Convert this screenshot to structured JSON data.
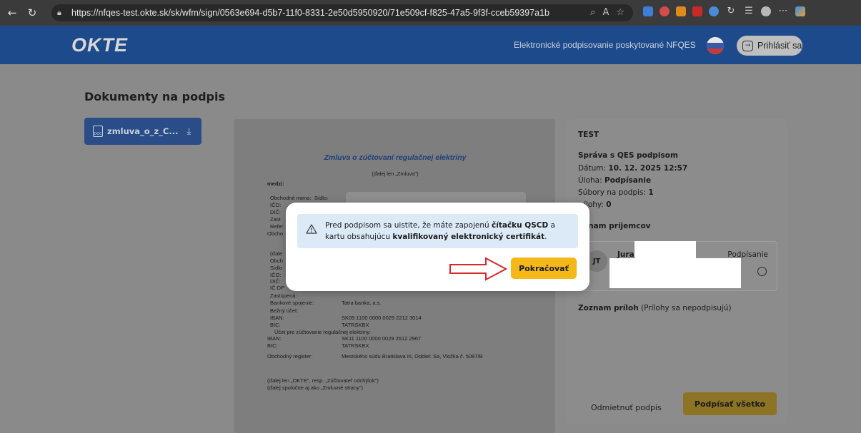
{
  "browser": {
    "url": "https://nfqes-test.okte.sk/sk/wfm/sign/0563e694-d5b7-11f0-8331-2e50d5950920/71e509cf-f825-47a5-9f3f-cceb59397a1b"
  },
  "header": {
    "logo": "OKTE",
    "service_text": "Elektronické podpisovanie poskytované NFQES",
    "login_label": "Prihlásiť sa"
  },
  "page": {
    "title": "Dokumenty na podpis",
    "document_tab": "zmluva_o_z_C..."
  },
  "document": {
    "title": "Zmluva o zúčtovaní regulačnej elektriny",
    "subtitle": "(ďalej len „Zmluva\")",
    "lines": {
      "medzi": "medzi:",
      "obchodne_meno": "Obchodné meno:",
      "sidlo": "Sídlo:",
      "ico": "IČO:",
      "dic": "DIČ:",
      "zast": "Zast",
      "refer": "Refer",
      "obcho": "Obcho",
      "dalej": "(ďale",
      "obch2": "Obch",
      "sidlo2": "Sídlo",
      "ico2": "IČO:",
      "dic2": "DIČ:",
      "icdph": "IČ DP",
      "zastupena": "Zastúpená:",
      "bankove_spojenie": "Bankové spojenie:",
      "bankove_spojenie_val": "Tatra banka, a.s.",
      "bezny_ucet": "Bežný účet:",
      "iban1": "IBAN:",
      "iban1_val": "SK09 1100 0000 0029 2212 3014",
      "bic1": "BIC:",
      "bic1_val": "TATRSKBX",
      "ucet_zuctovanie": "Účet pre zúčtovanie regulačnej elektriny:",
      "iban2": "IBAN:",
      "iban2_val": "SK11 1100 0000 0029 2612 2967",
      "bic2": "BIC:",
      "bic2_val": "TATRSKBX",
      "obchodny_register": "Obchodný register:",
      "obchodny_register_val": "Mestského súdu Bratislava III, Oddiel: Sa, Vložka č. 5087/B",
      "footer1": "(ďalej len „OKTE\", resp. „Zúčtovateľ odchýlok\")",
      "footer2": "(ďalej spoločne aj ako „Zmluvné strany\")"
    }
  },
  "info_panel": {
    "env": "TEST",
    "message_title": "Správa s QES podpisom",
    "date_label": "Dátum:",
    "date_value": "10. 12. 2025 12:57",
    "task_label": "Úloha:",
    "task_value": "Podpísanie",
    "files_label": "Súbory na podpis:",
    "files_value": "1",
    "attachments_label": "ílohy:",
    "attachments_value": "0",
    "recipients_heading": "znam príjemcov",
    "recipient_initials": "JT",
    "recipient_name": "Juraj",
    "recipient_status": "Podpísanie",
    "attachments_heading": "Zoznam príloh",
    "attachments_note": "(Prílohy sa nepodpisujú)",
    "reject_label": "Odmietnuť podpis",
    "sign_all_label": "Podpísať všetko"
  },
  "modal": {
    "text_1": "Pred podpisom sa uistite, že máte zapojenú ",
    "text_bold_1": "čítačku QSCD",
    "text_2": " a kartu obsahujúcu ",
    "text_bold_2": "kvalifikovaný elektronický certifikát",
    "text_3": ".",
    "continue_label": "Pokračovať"
  },
  "colors": {
    "header_bg": "#1d4a8a",
    "continue_button": "#f4b819",
    "alert_bg": "#dceaf8",
    "arrow": "#d9282c"
  }
}
